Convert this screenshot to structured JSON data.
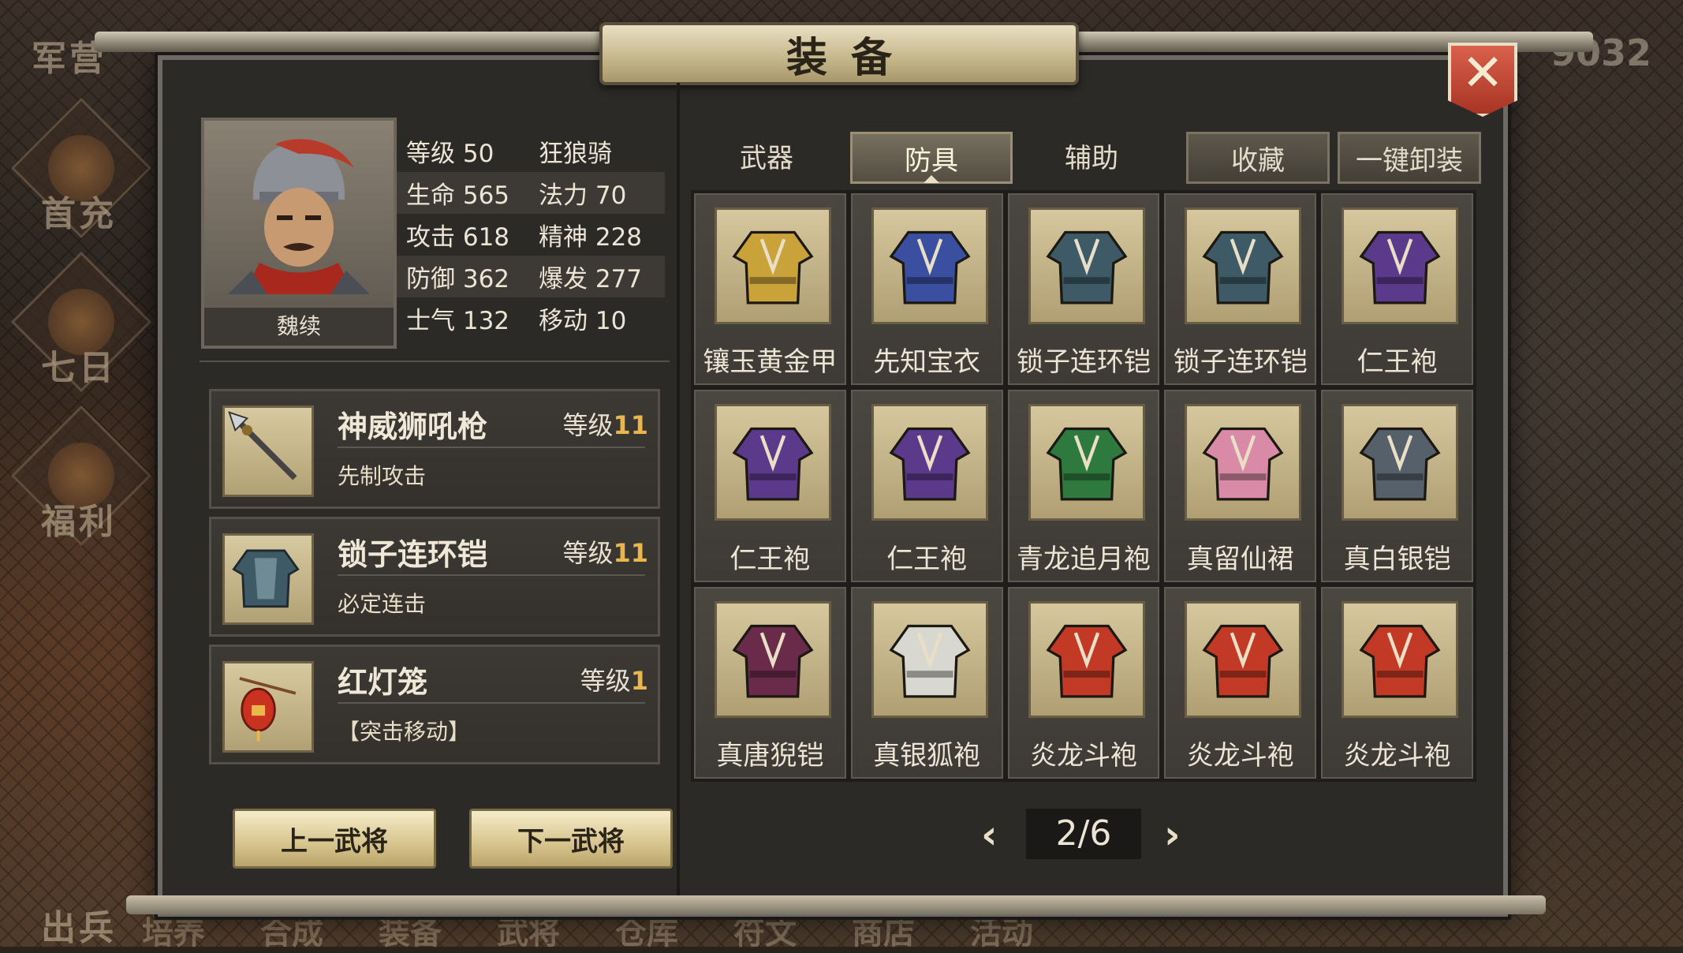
{
  "window": {
    "title": "装备",
    "close_label": "✕"
  },
  "background": {
    "top_left_label": "军营",
    "ghost_number": "9032",
    "side_menu": [
      "首充",
      "七日",
      "福利",
      "出兵"
    ],
    "bottom_nav": [
      "培养",
      "合成",
      "装备",
      "武将",
      "仓库",
      "符文",
      "商店",
      "活动"
    ]
  },
  "hero": {
    "name": "魏续",
    "stats": [
      {
        "label": "等级",
        "value": "50",
        "label2": "狂狼骑",
        "value2": ""
      },
      {
        "label": "生命",
        "value": "565",
        "label2": "法力",
        "value2": "70"
      },
      {
        "label": "攻击",
        "value": "618",
        "label2": "精神",
        "value2": "228"
      },
      {
        "label": "防御",
        "value": "362",
        "label2": "爆发",
        "value2": "277"
      },
      {
        "label": "士气",
        "value": "132",
        "label2": "移动",
        "value2": "10"
      }
    ]
  },
  "equipped": [
    {
      "name": "神威狮吼枪",
      "level_label": "等级",
      "level": "11",
      "skill": "先制攻击",
      "icon": "spear-icon"
    },
    {
      "name": "锁子连环铠",
      "level_label": "等级",
      "level": "11",
      "skill": "必定连击",
      "icon": "armor-icon"
    },
    {
      "name": "红灯笼",
      "level_label": "等级",
      "level": "1",
      "skill": "【突击移动】",
      "icon": "lantern-icon"
    }
  ],
  "buttons": {
    "prev_general": "上一武将",
    "next_general": "下一武将"
  },
  "tabs": [
    {
      "label": "武器",
      "active": false,
      "boxed": false
    },
    {
      "label": "防具",
      "active": true,
      "boxed": false
    },
    {
      "label": "辅助",
      "active": false,
      "boxed": false
    },
    {
      "label": "收藏",
      "active": false,
      "boxed": true
    },
    {
      "label": "一键卸装",
      "active": false,
      "boxed": true
    }
  ],
  "inventory": [
    {
      "name": "镶玉黄金甲",
      "color": "#c9a23a"
    },
    {
      "name": "先知宝衣",
      "color": "#3b4fa0"
    },
    {
      "name": "锁子连环铠",
      "color": "#3d5a66"
    },
    {
      "name": "锁子连环铠",
      "color": "#3d5a66"
    },
    {
      "name": "仁王袍",
      "color": "#5b3a8c"
    },
    {
      "name": "仁王袍",
      "color": "#5b3a8c"
    },
    {
      "name": "仁王袍",
      "color": "#5b3a8c"
    },
    {
      "name": "青龙追月袍",
      "color": "#2e7a3e"
    },
    {
      "name": "真留仙裙",
      "color": "#d98aa6"
    },
    {
      "name": "真白银铠",
      "color": "#55606a"
    },
    {
      "name": "真唐猊铠",
      "color": "#6a2b4a"
    },
    {
      "name": "真银狐袍",
      "color": "#d8d8d0"
    },
    {
      "name": "炎龙斗袍",
      "color": "#c23a26"
    },
    {
      "name": "炎龙斗袍",
      "color": "#c23a26"
    },
    {
      "name": "炎龙斗袍",
      "color": "#c23a26"
    }
  ],
  "pager": {
    "current": "2/6",
    "prev": "‹",
    "next": "›"
  }
}
